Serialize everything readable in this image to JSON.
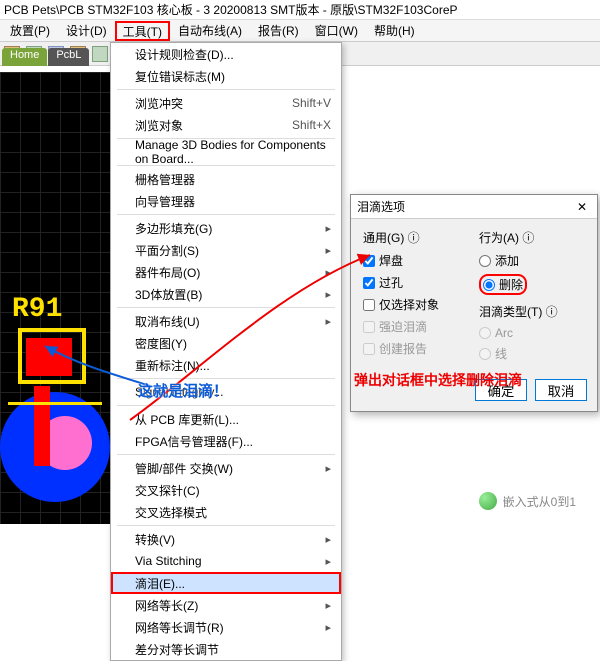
{
  "titlebar": "PCB Pets\\PCB STM32F103 核心板 - 3 20200813 SMT版本 - 原版\\STM32F103CoreP",
  "menubar": {
    "items": [
      "放置(P)",
      "设计(D)",
      "工具(T)",
      "自动布线(A)",
      "报告(R)",
      "窗口(W)",
      "帮助(H)"
    ],
    "highlight_index": 2
  },
  "tabs": {
    "home": "Home",
    "pcb": "PcbL"
  },
  "dropdown": {
    "items": [
      {
        "label": "设计规则检查(D)..."
      },
      {
        "label": "复位错误标志(M)"
      },
      {
        "sep": true
      },
      {
        "label": "浏览冲突",
        "shortcut": "Shift+V"
      },
      {
        "label": "浏览对象",
        "shortcut": "Shift+X"
      },
      {
        "sep": true
      },
      {
        "label": "Manage 3D Bodies for Components on Board..."
      },
      {
        "sep": true
      },
      {
        "label": "栅格管理器"
      },
      {
        "label": "向导管理器"
      },
      {
        "sep": true
      },
      {
        "label": "多边形填充(G)",
        "arrow": true
      },
      {
        "label": "平面分割(S)",
        "arrow": true
      },
      {
        "label": "器件布局(O)",
        "arrow": true
      },
      {
        "label": "3D体放置(B)",
        "arrow": true
      },
      {
        "sep": true
      },
      {
        "label": "取消布线(U)",
        "arrow": true
      },
      {
        "label": "密度图(Y)"
      },
      {
        "label": "重新标注(N)..."
      },
      {
        "sep": true
      },
      {
        "label": "Signal Integrity..."
      },
      {
        "sep": true
      },
      {
        "label": "从 PCB 库更新(L)..."
      },
      {
        "label": "FPGA信号管理器(F)..."
      },
      {
        "sep": true
      },
      {
        "label": "管脚/部件 交换(W)",
        "arrow": true
      },
      {
        "label": "交叉探针(C)"
      },
      {
        "label": "交叉选择模式"
      },
      {
        "sep": true
      },
      {
        "label": "转换(V)",
        "arrow": true
      },
      {
        "label": "Via Stitching",
        "arrow": true
      },
      {
        "label": "滴泪(E)...",
        "selected": true
      },
      {
        "label": "网络等长(Z)",
        "arrow": true
      },
      {
        "label": "网络等长调节(R)",
        "arrow": true
      },
      {
        "label": "差分对等长调节"
      }
    ]
  },
  "dialog": {
    "title": "泪滴选项",
    "left_header": "通用(G)",
    "right_header": "行为(A)",
    "opt_pad": "焊盘",
    "opt_via": "过孔",
    "opt_sel": "仅选择对象",
    "opt_force": "强迫泪滴",
    "opt_report": "创建报告",
    "opt_add": "添加",
    "opt_del": "删除",
    "td_type": "泪滴类型(T)",
    "opt_arc": "Arc",
    "opt_line": "线",
    "ok": "确定",
    "cancel": "取消"
  },
  "canvas": {
    "refdes": "R91"
  },
  "annot1": "这就是泪滴！",
  "annot2": "弹出对话框中选择删除泪滴",
  "watermark": "嵌入式从0到1"
}
